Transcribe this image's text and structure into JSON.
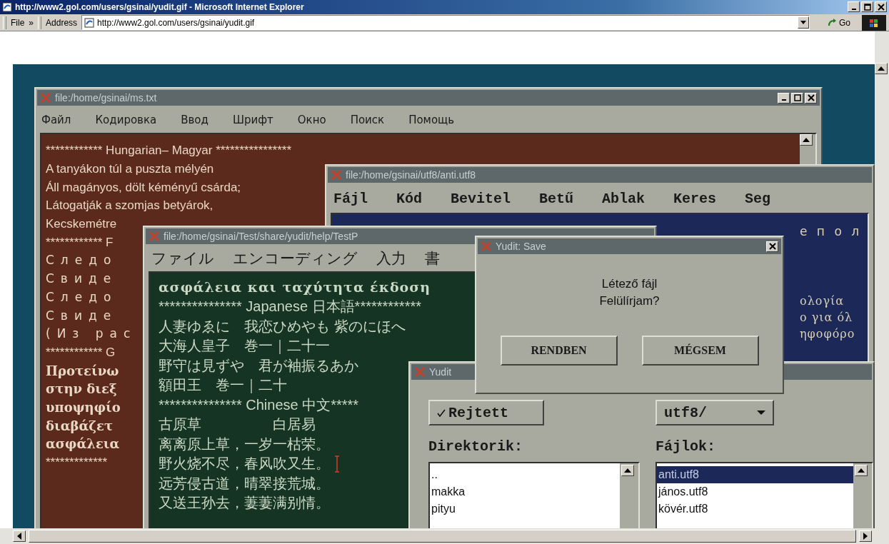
{
  "browser": {
    "title": "http://www2.gol.com/users/gsinai/yudit.gif - Microsoft Internet Explorer",
    "menu": [
      "File"
    ],
    "chevron": "»",
    "address_label": "Address",
    "address": "http://www2.gol.com/users/gsinai/yudit.gif",
    "go": "Go"
  },
  "windows": {
    "ms_txt": {
      "title": "file:/home/gsinai/ms.txt",
      "menu": [
        "Файл",
        "Кодировка",
        "Ввод",
        "Шрифт",
        "Окно",
        "Поиск",
        "Помощь"
      ],
      "lines": [
        {
          "text": "************ Hungarian– Magyar ****************",
          "kind": "plain"
        },
        {
          "text": "A tanyákon túl a puszta mélyén",
          "kind": "plain"
        },
        {
          "text": "Áll magányos, dölt kéményű csárda;",
          "kind": "plain"
        },
        {
          "text": "Látogatják a szomjas betyárok,",
          "kind": "plain"
        },
        {
          "text": "Kecskemétre",
          "kind": "plain"
        },
        {
          "text": "************ F",
          "kind": "plain"
        },
        {
          "text": "Следо",
          "kind": "spaced"
        },
        {
          "text": "Свиде",
          "kind": "spaced"
        },
        {
          "text": "Следо",
          "kind": "spaced"
        },
        {
          "text": "Свиде",
          "kind": "spaced"
        },
        {
          "text": "(Из рас",
          "kind": "spaced"
        },
        {
          "text": "************ G",
          "kind": "plain"
        },
        {
          "text": "Προτείνω",
          "kind": "greek"
        },
        {
          "text": "στην διεξ",
          "kind": "greek"
        },
        {
          "text": "υποψηφίο",
          "kind": "greek"
        },
        {
          "text": "διαβάζετ",
          "kind": "greek"
        },
        {
          "text": "ασφάλεια",
          "kind": "greek"
        },
        {
          "text": "*************",
          "kind": "plain"
        }
      ]
    },
    "anti_utf8": {
      "title": "file:/home/gsinai/utf8/anti.utf8",
      "menu": [
        "Fájl",
        "Kód",
        "Bevitel",
        "Betű",
        "Ablak",
        "Keres",
        "Seg"
      ],
      "lines": [
        {
          "text": "е п о л",
          "kind": "spaced"
        },
        {
          "text": "ολογία",
          "kind": "greek"
        },
        {
          "text": "ο για όλ",
          "kind": "greek"
        },
        {
          "text": "ηφοφόρο",
          "kind": "greek"
        }
      ]
    },
    "testp": {
      "title": "file:/home/gsinai/Test/share/yudit/help/TestP",
      "menu": [
        "ファイル",
        "エンコーディング",
        "入力",
        "書"
      ],
      "lines": [
        {
          "text": "ασφάλεια και ταχύτητα έκδοση",
          "kind": "greek",
          "cursor": false
        },
        {
          "text": "*************** Japanese 日本語************",
          "kind": "plain",
          "cursor": false
        },
        {
          "text": "人妻ゆゑに　我恋ひめやも 紫のにほへ",
          "kind": "plain",
          "cursor": false
        },
        {
          "text": "大海人皇子　巻一｜二十一",
          "kind": "plain",
          "cursor": false
        },
        {
          "text": "野守は見ずや　君が袖振るあか",
          "kind": "plain",
          "cursor": false
        },
        {
          "text": "額田王　巻一｜二十",
          "kind": "plain",
          "cursor": false
        },
        {
          "text": "*************** Chinese 中文*****",
          "kind": "plain",
          "cursor": false
        },
        {
          "text": "古原草　　　　　白居易",
          "kind": "plain",
          "cursor": false
        },
        {
          "text": "离离原上草，一岁一枯荣。",
          "kind": "plain",
          "cursor": false
        },
        {
          "text": "野火烧不尽，春风吹又生。",
          "kind": "plain",
          "cursor": true
        },
        {
          "text": "远芳侵古道，晴翠接荒城。",
          "kind": "plain",
          "cursor": false
        },
        {
          "text": "又送王孙去，萋萋满别情。",
          "kind": "plain",
          "cursor": false
        }
      ]
    },
    "file_dialog": {
      "title": "Yudit",
      "hidden_toggle": {
        "label": "Rejtett",
        "checked": true
      },
      "folder": "utf8/",
      "dirs_label": "Direktorik:",
      "files_label": "Fájlok:",
      "dirs": [
        {
          "name": "..",
          "selected": false
        },
        {
          "name": "makka",
          "selected": false
        },
        {
          "name": "pityu",
          "selected": false
        }
      ],
      "files": [
        {
          "name": "anti.utf8",
          "selected": true
        },
        {
          "name": "jános.utf8",
          "selected": false
        },
        {
          "name": "kövér.utf8",
          "selected": false
        }
      ]
    },
    "save_dialog": {
      "title": "Yudit: Save",
      "message": [
        "Létező fájl",
        "Felülírjam?"
      ],
      "buttons": [
        "RENDBEN",
        "MÉGSEM"
      ]
    }
  }
}
